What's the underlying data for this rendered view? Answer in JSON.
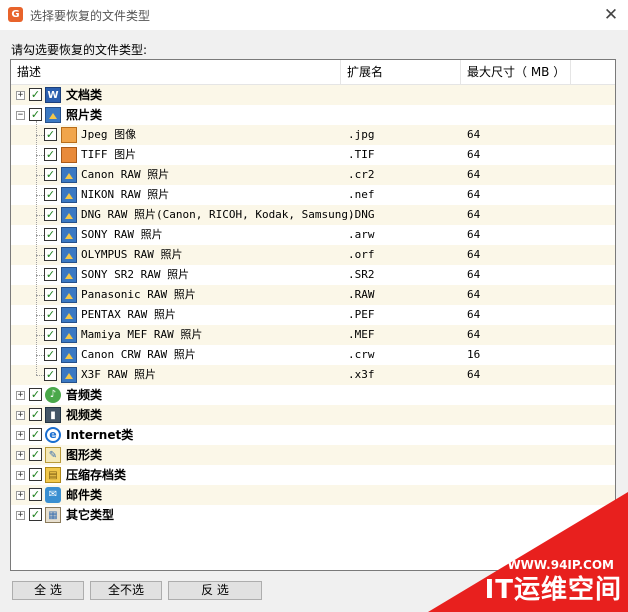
{
  "window": {
    "title": "选择要恢复的文件类型",
    "app_icon_letter": "G"
  },
  "prompt": "请勾选要恢复的文件类型:",
  "columns": {
    "desc": "描述",
    "ext": "扩展名",
    "size": "最大尺寸（ MB ）"
  },
  "categories": [
    {
      "label": "文档类",
      "expander": "+",
      "icon": "word-doc-icon"
    },
    {
      "label": "照片类",
      "expander": "−",
      "icon": "photo-icon"
    },
    {
      "label": "音频类",
      "expander": "+",
      "icon": "audio-icon"
    },
    {
      "label": "视频类",
      "expander": "+",
      "icon": "video-icon"
    },
    {
      "label": "Internet类",
      "expander": "+",
      "icon": "internet-explorer-icon"
    },
    {
      "label": "图形类",
      "expander": "+",
      "icon": "graphic-icon"
    },
    {
      "label": "压缩存档类",
      "expander": "+",
      "icon": "archive-icon"
    },
    {
      "label": "邮件类",
      "expander": "+",
      "icon": "mail-icon"
    },
    {
      "label": "其它类型",
      "expander": "+",
      "icon": "other-files-icon"
    }
  ],
  "photo_types": [
    {
      "label": "Jpeg 图像",
      "ext": ".jpg",
      "size": "64"
    },
    {
      "label": "TIFF 图片",
      "ext": ".TIF",
      "size": "64"
    },
    {
      "label": "Canon RAW 照片",
      "ext": ".cr2",
      "size": "64"
    },
    {
      "label": "NIKON RAW 照片",
      "ext": ".nef",
      "size": "64"
    },
    {
      "label": "DNG RAW 照片(Canon, RICOH, Kodak, Samsung)",
      "ext": ".DNG",
      "size": "64"
    },
    {
      "label": "SONY RAW 照片",
      "ext": ".arw",
      "size": "64"
    },
    {
      "label": "OLYMPUS RAW 照片",
      "ext": ".orf",
      "size": "64"
    },
    {
      "label": "SONY SR2 RAW 照片",
      "ext": ".SR2",
      "size": "64"
    },
    {
      "label": "Panasonic RAW 照片",
      "ext": ".RAW",
      "size": "64"
    },
    {
      "label": "PENTAX RAW 照片",
      "ext": ".PEF",
      "size": "64"
    },
    {
      "label": "Mamiya MEF RAW 照片",
      "ext": ".MEF",
      "size": "64"
    },
    {
      "label": "Canon CRW RAW 照片",
      "ext": ".crw",
      "size": "16"
    },
    {
      "label": "X3F RAW 照片",
      "ext": ".x3f",
      "size": "64"
    }
  ],
  "checkmark": "✓",
  "buttons": {
    "select_all": "全 选",
    "select_none": "全不选",
    "invert": "反 选"
  },
  "watermark": {
    "url": "WWW.94IP.COM",
    "brand": "IT运维空间"
  },
  "colors": {
    "check": "#1a7f1a",
    "highlight_row": "#fbf7e8",
    "watermark_red": "#e8201e"
  }
}
